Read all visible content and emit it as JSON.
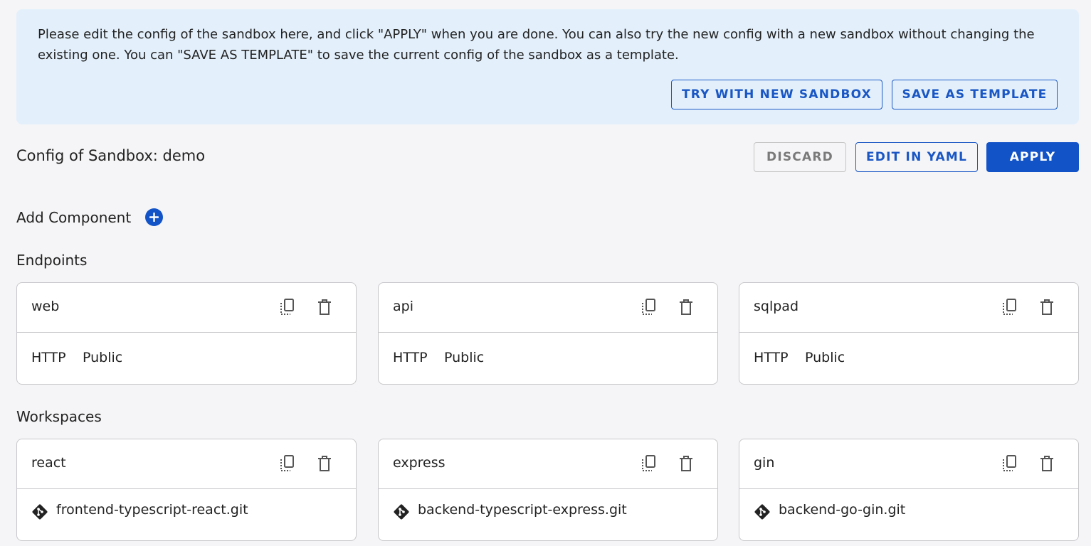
{
  "banner": {
    "text": "Please edit the config of the sandbox here, and click \"APPLY\" when you are done. You can also try the new config with a new sandbox without changing the existing one. You can \"SAVE AS TEMPLATE\" to save the current config of the sandbox as a template.",
    "try_label": "TRY WITH NEW SANDBOX",
    "save_label": "SAVE AS TEMPLATE"
  },
  "header": {
    "title": "Config of Sandbox: demo",
    "discard_label": "DISCARD",
    "edit_yaml_label": "EDIT IN YAML",
    "apply_label": "APPLY"
  },
  "add_component": {
    "label": "Add Component",
    "icon": "plus-circle-icon"
  },
  "endpoints": {
    "title": "Endpoints",
    "items": [
      {
        "name": "web",
        "protocol": "HTTP",
        "visibility": "Public"
      },
      {
        "name": "api",
        "protocol": "HTTP",
        "visibility": "Public"
      },
      {
        "name": "sqlpad",
        "protocol": "HTTP",
        "visibility": "Public"
      }
    ]
  },
  "workspaces": {
    "title": "Workspaces",
    "items": [
      {
        "name": "react",
        "repo": "frontend-typescript-react.git"
      },
      {
        "name": "express",
        "repo": "backend-typescript-express.git"
      },
      {
        "name": "gin",
        "repo": "backend-go-gin.git"
      }
    ]
  },
  "colors": {
    "accent": "#1253c8",
    "banner_bg": "#e3f0fc",
    "page_bg": "#f5f5f7"
  }
}
